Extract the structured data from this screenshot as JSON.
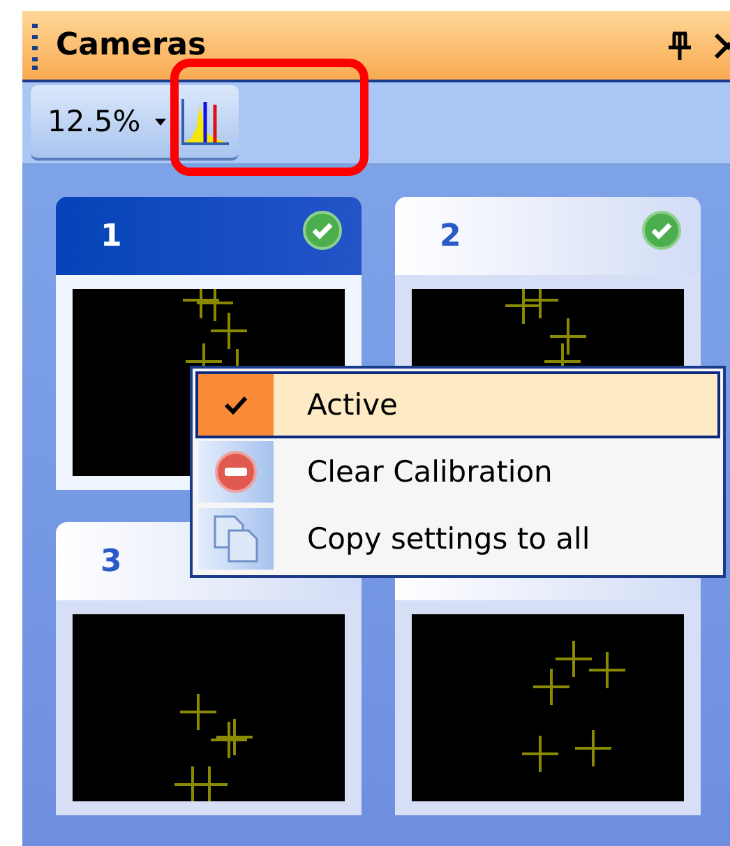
{
  "panel": {
    "title": "Cameras"
  },
  "toolbar": {
    "zoom": "12.5%"
  },
  "cameras": [
    {
      "number": "1",
      "selected": true,
      "active": true
    },
    {
      "number": "2",
      "selected": false,
      "active": true
    },
    {
      "number": "3",
      "selected": false
    },
    {
      "selected": false
    }
  ],
  "context_menu": {
    "items": [
      {
        "kind": "check",
        "label": "Active",
        "checked": true,
        "selected": true
      },
      {
        "kind": "clear",
        "label": "Clear Calibration",
        "selected": false
      },
      {
        "kind": "copy",
        "label": "Copy settings to all",
        "selected": false
      }
    ]
  }
}
